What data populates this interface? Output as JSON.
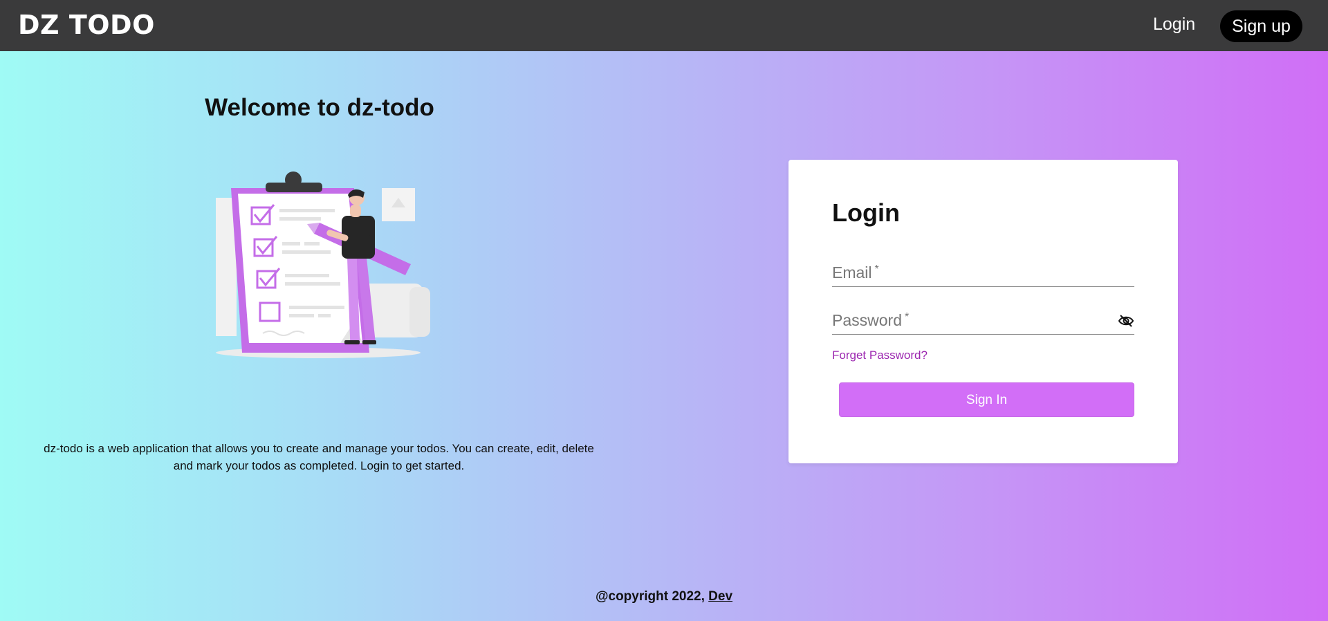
{
  "navbar": {
    "brand": "DZ TODO",
    "login_label": "Login",
    "signup_label": "Sign up"
  },
  "hero": {
    "title": "Welcome to dz-todo",
    "description": "dz-todo is a web application that allows you to create and manage your todos. You can create, edit, delete and mark your todos as completed. Login to get started."
  },
  "login_card": {
    "title": "Login",
    "email_label": "Email",
    "password_label": "Password",
    "required_mark": "*",
    "forgot_label": "Forget Password?",
    "submit_label": "Sign In"
  },
  "footer": {
    "copyright": "@copyright 2022, ",
    "author_link": "Dev"
  },
  "icons": {
    "password_toggle": "eye-off-icon",
    "hero_image": "checklist-illustration"
  },
  "colors": {
    "navbar_bg": "#3a3a3b",
    "accent": "#d26ef7",
    "link": "#9c27b0",
    "gradient_start": "#9ffbf5",
    "gradient_end": "#d06ef6"
  }
}
